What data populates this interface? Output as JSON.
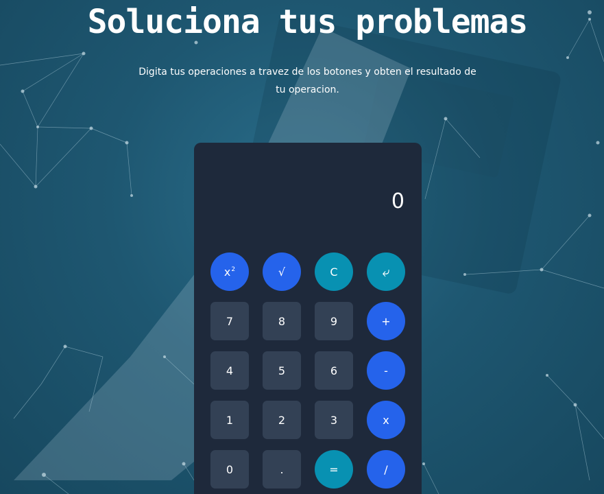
{
  "header": {
    "title": "Soluciona tus problemas",
    "subtitle": "Digita tus operaciones a travez de los botones y obten el resultado de tu operacion."
  },
  "calculator": {
    "display_value": "0",
    "keys": {
      "square": "x",
      "square_sup": "2",
      "sqrt": "√",
      "clear": "C",
      "backspace_icon": "return-arrow-icon",
      "backspace": "⤶",
      "seven": "7",
      "eight": "8",
      "nine": "9",
      "plus": "+",
      "four": "4",
      "five": "5",
      "six": "6",
      "minus": "-",
      "one": "1",
      "two": "2",
      "three": "3",
      "multiply": "x",
      "zero": "0",
      "dot": ".",
      "equals": "=",
      "divide": "/"
    }
  },
  "colors": {
    "background": "#1f5470",
    "panel": "#1e293b",
    "number_key": "#334155",
    "operator_key": "#2563eb",
    "action_key": "#0891b2",
    "text": "#ffffff"
  }
}
